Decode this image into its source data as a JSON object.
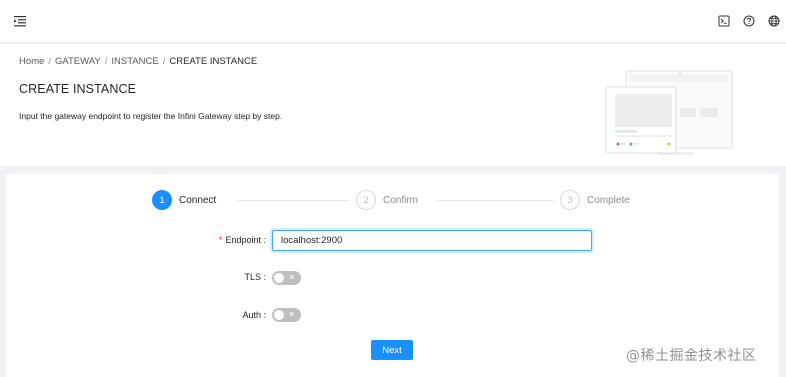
{
  "topbar": {
    "menu_icon": "menu-fold-icon",
    "tools": [
      {
        "name": "console",
        "icon": "terminal-icon"
      },
      {
        "name": "help",
        "icon": "question-circle-icon"
      },
      {
        "name": "language",
        "icon": "globe-icon"
      }
    ]
  },
  "breadcrumb": {
    "items": [
      "Home",
      "GATEWAY",
      "INSTANCE",
      "CREATE INSTANCE"
    ],
    "separator": "/"
  },
  "page": {
    "title": "CREATE INSTANCE",
    "description": "Input the gateway endpoint to register the Infini Gateway step by step."
  },
  "steps": [
    {
      "number": "1",
      "label": "Connect",
      "status": "active"
    },
    {
      "number": "2",
      "label": "Confirm",
      "status": "wait"
    },
    {
      "number": "3",
      "label": "Complete",
      "status": "wait"
    }
  ],
  "form": {
    "endpoint": {
      "required_mark": "*",
      "label": "Endpoint",
      "colon": ":",
      "value": "localhost:2900"
    },
    "tls": {
      "label": "TLS",
      "colon": ":",
      "checked": false,
      "off_glyph": "✕"
    },
    "auth": {
      "label": "Auth",
      "colon": ":",
      "checked": false,
      "off_glyph": "✕"
    },
    "next_label": "Next"
  },
  "watermark": "@稀土掘金技术社区",
  "colors": {
    "primary": "#1890ff",
    "required": "#f5222d",
    "switch_off": "#bfbfbf",
    "page_bg": "#f0f2f5"
  }
}
